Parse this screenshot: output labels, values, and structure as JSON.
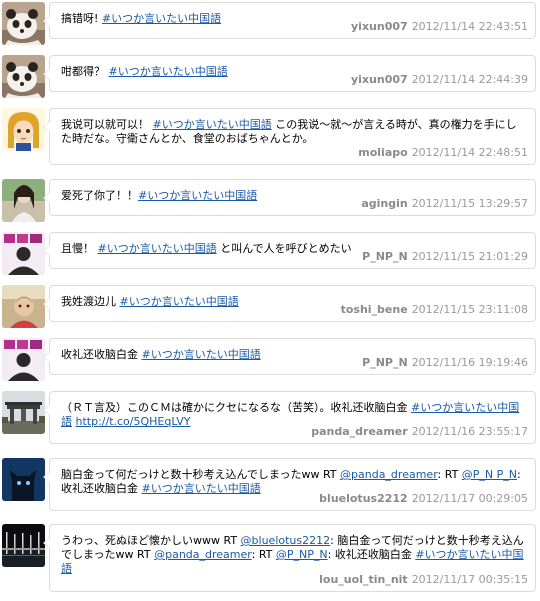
{
  "tweets": [
    {
      "avatar": "panda-avatar",
      "parts": [
        {
          "t": "text",
          "v": "搞错呀! "
        },
        {
          "t": "link",
          "v": "#いつか言いたい中国語"
        }
      ],
      "user": "yixun007",
      "time": "2012/11/14 22:43:51"
    },
    {
      "avatar": "panda-avatar",
      "parts": [
        {
          "t": "text",
          "v": "咁都得？ "
        },
        {
          "t": "link",
          "v": "#いつか言いたい中国語"
        }
      ],
      "user": "yixun007",
      "time": "2012/11/14 22:44:39"
    },
    {
      "avatar": "anime-girl-avatar",
      "parts": [
        {
          "t": "text",
          "v": "我说可以就可以！ "
        },
        {
          "t": "link",
          "v": "#いつか言いたい中国語"
        },
        {
          "t": "text",
          "v": " この我说～就～が言える時が、真の権力を手にした時だな。守衛さんとか、食堂のおばちゃんとか。"
        }
      ],
      "user": "moliapo",
      "time": "2012/11/14 22:48:51"
    },
    {
      "avatar": "photo-woman-avatar",
      "parts": [
        {
          "t": "text",
          "v": "爱死了你了！！"
        },
        {
          "t": "link",
          "v": "#いつか言いたい中国語"
        }
      ],
      "user": "agingin",
      "time": "2012/11/15 13:29:57"
    },
    {
      "avatar": "silhouette-avatar",
      "parts": [
        {
          "t": "text",
          "v": "且慢！ "
        },
        {
          "t": "link",
          "v": "#いつか言いたい中国語"
        },
        {
          "t": "text",
          "v": " と叫んで人を呼びとめたい"
        }
      ],
      "user": "P_NP_N",
      "time": "2012/11/15 21:01:29"
    },
    {
      "avatar": "toddler-photo-avatar",
      "parts": [
        {
          "t": "text",
          "v": "我姓渡边儿 "
        },
        {
          "t": "link",
          "v": "#いつか言いたい中国語"
        }
      ],
      "user": "toshi_bene",
      "time": "2012/11/15 23:11:08"
    },
    {
      "avatar": "silhouette-avatar",
      "parts": [
        {
          "t": "text",
          "v": "收礼还收脑白金 "
        },
        {
          "t": "link",
          "v": "#いつか言いたい中国語"
        }
      ],
      "user": "P_NP_N",
      "time": "2012/11/16 19:19:46"
    },
    {
      "avatar": "gate-photo-avatar",
      "parts": [
        {
          "t": "text",
          "v": "（ＲＴ言及）このＣＭは確かにクセになるな（苦笑）。收礼还收脑白金 "
        },
        {
          "t": "link",
          "v": "#いつか言いたい中国語"
        },
        {
          "t": "text",
          "v": " "
        },
        {
          "t": "link",
          "v": "http://t.co/5QHEqLVY"
        }
      ],
      "user": "panda_dreamer",
      "time": "2012/11/16 23:55:17"
    },
    {
      "avatar": "cat-avatar",
      "parts": [
        {
          "t": "text",
          "v": "脑白金って何だっけと数十秒考え込んでしまったww RT "
        },
        {
          "t": "link",
          "v": "@panda_dreamer"
        },
        {
          "t": "text",
          "v": ": RT "
        },
        {
          "t": "link",
          "v": "@P_N P_N"
        },
        {
          "t": "text",
          "v": ": 收礼还收脑白金 "
        },
        {
          "t": "link",
          "v": "#いつか言いたい中国語"
        }
      ],
      "user": "bluelotus2212",
      "time": "2012/11/17 00:29:05"
    },
    {
      "avatar": "night-pier-avatar",
      "parts": [
        {
          "t": "text",
          "v": "うわっ、死ぬほど懐かしいwww RT "
        },
        {
          "t": "link",
          "v": "@bluelotus2212"
        },
        {
          "t": "text",
          "v": ": 脑白金って何だっけと数十秒考え込んでしまったww RT "
        },
        {
          "t": "link",
          "v": "@panda_dreamer"
        },
        {
          "t": "text",
          "v": ": RT "
        },
        {
          "t": "link",
          "v": "@P_NP_N"
        },
        {
          "t": "text",
          "v": ": 收礼还收脑白金 "
        },
        {
          "t": "link",
          "v": "#いつか言いたい中国語"
        }
      ],
      "user": "lou_uol_tin_nit",
      "time": "2012/11/17 00:35:15"
    }
  ],
  "colors": {
    "link": "#1a5aa6",
    "username": "#8a8a8a",
    "timestamp": "#9a9a9a",
    "bubble_border": "#dcdcdc"
  }
}
